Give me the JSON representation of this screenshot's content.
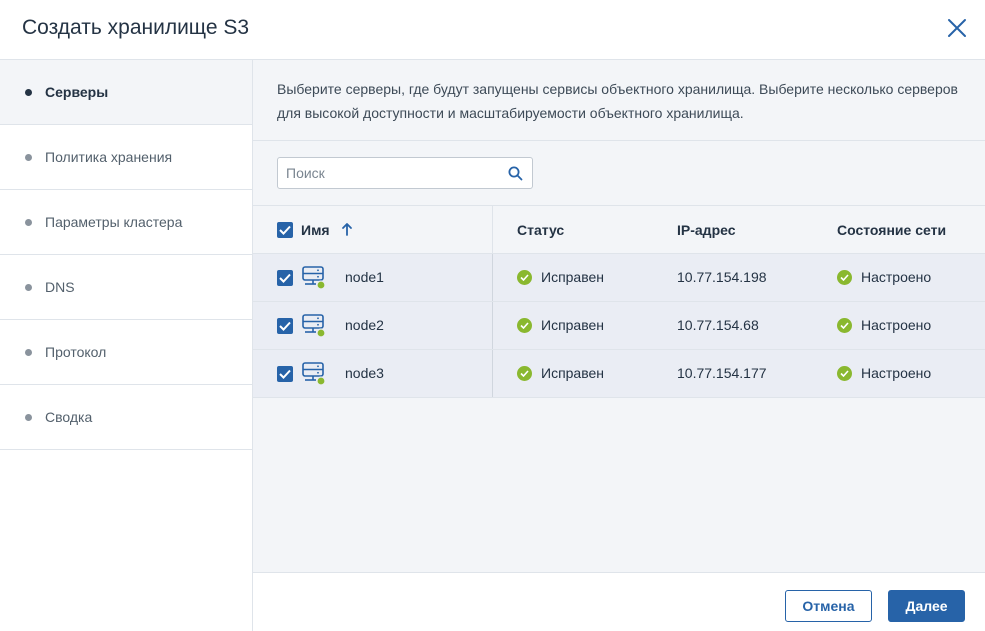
{
  "dialog": {
    "title": "Создать хранилище S3"
  },
  "steps": [
    {
      "label": "Серверы",
      "active": true
    },
    {
      "label": "Политика хранения"
    },
    {
      "label": "Параметры кластера"
    },
    {
      "label": "DNS"
    },
    {
      "label": "Протокол"
    },
    {
      "label": "Сводка"
    }
  ],
  "description": "Выберите серверы, где будут запущены сервисы объектного хранилища. Выберите несколько серверов для высокой доступности и масштабируемости объектного хранилища.",
  "search": {
    "placeholder": "Поиск",
    "value": ""
  },
  "table": {
    "columns": {
      "name": "Имя",
      "status": "Статус",
      "ip": "IP-адрес",
      "network": "Состояние сети"
    },
    "rows": [
      {
        "name": "node1",
        "status": "Исправен",
        "ip": "10.77.154.198",
        "network": "Настроено",
        "checked": true
      },
      {
        "name": "node2",
        "status": "Исправен",
        "ip": "10.77.154.68",
        "network": "Настроено",
        "checked": true
      },
      {
        "name": "node3",
        "status": "Исправен",
        "ip": "10.77.154.177",
        "network": "Настроено",
        "checked": true
      }
    ]
  },
  "footer": {
    "cancel_label": "Отмена",
    "next_label": "Далее"
  },
  "colors": {
    "accent": "#2763a8",
    "ok_green": "#8ab82f",
    "row_bg": "#eaedf4"
  }
}
